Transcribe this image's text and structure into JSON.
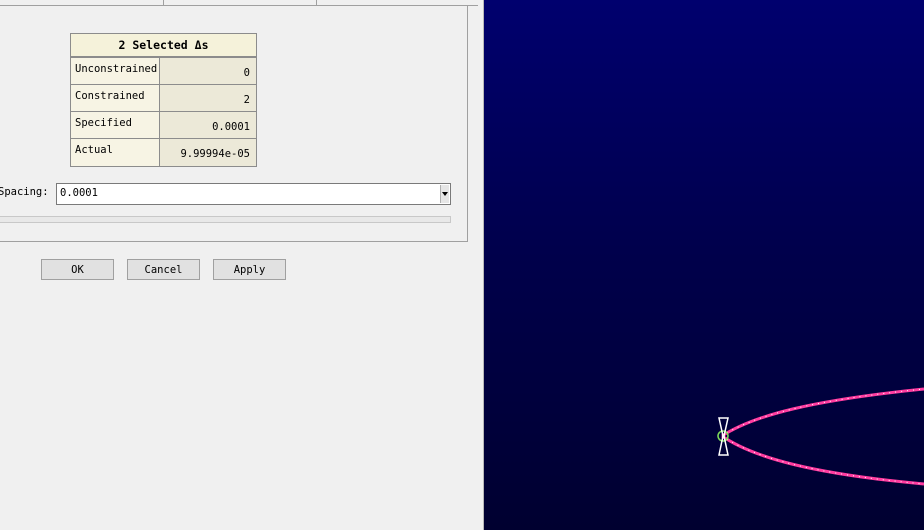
{
  "stats_table": {
    "title": "2 Selected Δs",
    "rows": [
      {
        "label": "Unconstrained",
        "value": "0"
      },
      {
        "label": "Constrained",
        "value": "2"
      },
      {
        "label": "Specified",
        "value": "0.0001"
      },
      {
        "label": "Actual",
        "value": "9.99994e-05"
      }
    ]
  },
  "spacing": {
    "label": "Spacing:",
    "value": "0.0001"
  },
  "buttons": {
    "ok": "OK",
    "cancel": "Cancel",
    "apply": "Apply"
  },
  "colors": {
    "viewport_top": "#00006e",
    "viewport_bottom": "#000030",
    "curve": "#ff3ca0",
    "curve_highlight": "#ffffff",
    "point_marker": "#7fdc5a"
  },
  "icons": {
    "combo_arrow": "chevron-down-icon",
    "spacing_marker": "hourglass-marker-icon"
  }
}
